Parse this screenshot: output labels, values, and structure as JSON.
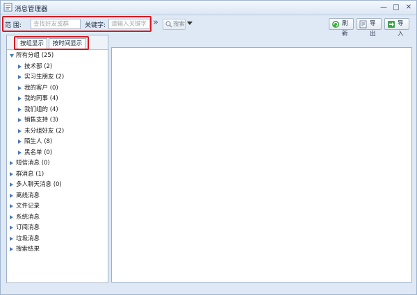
{
  "window": {
    "title": "消息管理器"
  },
  "toolbar": {
    "range_label": "范  围:",
    "range_placeholder": "查找好友或群",
    "keyword_label": "关键字:",
    "keyword_placeholder": "请输入关键字",
    "more_glyph": "»",
    "search_label": "搜索",
    "refresh_label": "刷新",
    "export_label": "导出",
    "import_label": "导入"
  },
  "tabs": [
    {
      "label": "按组显示",
      "active": true
    },
    {
      "label": "按时间显示",
      "active": false
    }
  ],
  "tree": {
    "root": {
      "label": "所有分组 (25)",
      "expanded": true
    },
    "groups": [
      {
        "label": "技术部 (2)"
      },
      {
        "label": "实习生朋友 (2)"
      },
      {
        "label": "我的客户 (0)"
      },
      {
        "label": "我的同事 (4)"
      },
      {
        "label": "我们组的 (4)"
      },
      {
        "label": "销售支持 (3)"
      },
      {
        "label": "未分组好友 (2)"
      },
      {
        "label": "陌生人 (8)"
      },
      {
        "label": "黑名单 (0)"
      }
    ],
    "categories": [
      {
        "label": "短信消息 (0)"
      },
      {
        "label": "群消息 (1)"
      },
      {
        "label": "多人聊天消息 (0)"
      },
      {
        "label": "离线消息"
      },
      {
        "label": "文件记录"
      },
      {
        "label": "系统消息"
      },
      {
        "label": "订阅消息"
      },
      {
        "label": "垃圾消息"
      },
      {
        "label": "搜索结果"
      }
    ]
  },
  "colors": {
    "highlight": "#d6181f",
    "arrow": "#4a78b8"
  }
}
